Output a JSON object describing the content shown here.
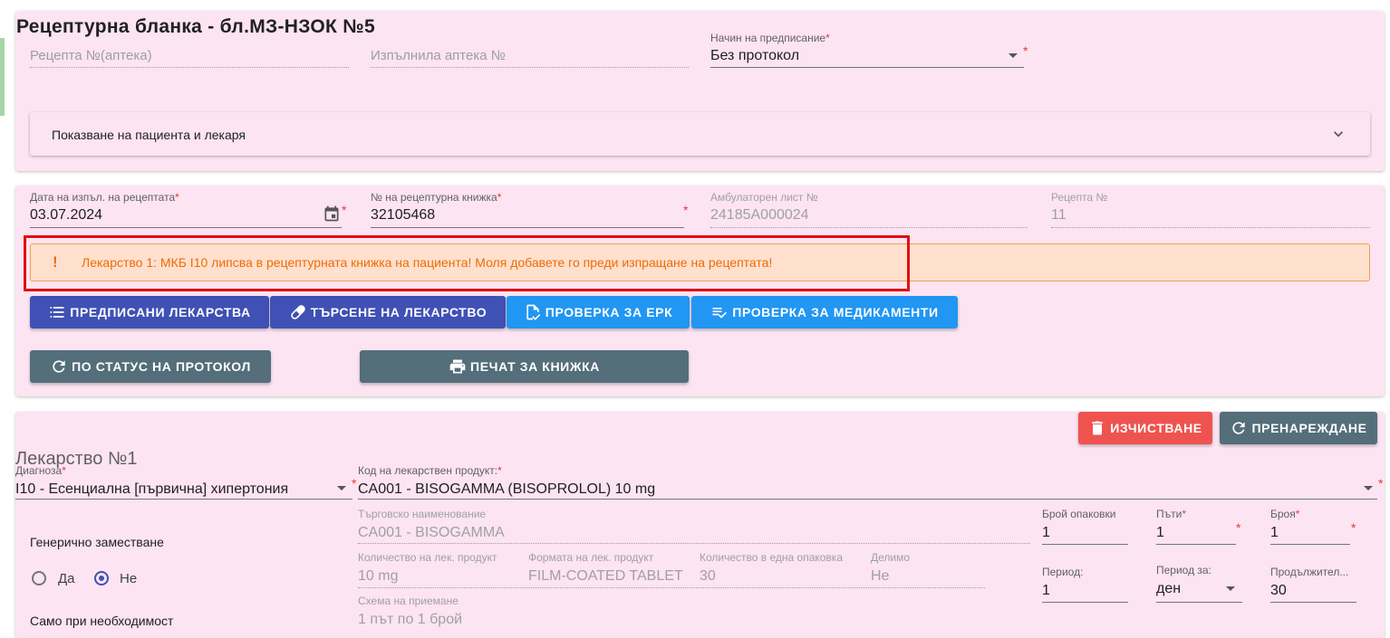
{
  "header": {
    "title": "Рецептурна бланка - бл.МЗ-НЗОК №5",
    "recipe_no_placeholder": "Рецепта №(аптека)",
    "pharmacy_placeholder": "Изпълнила аптека №",
    "method_label": "Начин на предписание",
    "method_value": "Без протокол",
    "expander_label": "Показване на пациента и лекаря"
  },
  "execution": {
    "date_label": "Дата на изпъл. на рецептата",
    "date_value": "03.07.2024",
    "book_label": "№ на рецептурна книжка",
    "book_value": "32105468",
    "amb_label": "Амбулаторен лист №",
    "amb_value": "24185A000024",
    "recipe_label": "Рецепта №",
    "recipe_value": "11"
  },
  "alert": {
    "icon": "!",
    "text": "Лекарство 1: МКБ I10 липсва в рецептурната книжка на пациента! Моля добавете го преди изпращане на рецептата!",
    "color": "#ef6c00"
  },
  "buttons": {
    "prescribed": "ПРЕДПИСАНИ ЛЕКАРСТВА",
    "search": "ТЪРСЕНЕ НА ЛЕКАРСТВО",
    "erk": "ПРОВЕРКА ЗА ЕРК",
    "medications": "ПРОВЕРКА ЗА МЕДИКАМЕНТИ",
    "protocol_status": "ПО СТАТУС НА ПРОТОКОЛ",
    "print": "ПЕЧАТ ЗА КНИЖКА",
    "clear": "ИЗЧИСТВАНЕ",
    "reorder": "ПРЕНАРЕЖДАНЕ"
  },
  "drug": {
    "heading": "Лекарство №1",
    "diagnosis_label": "Диагноза",
    "diagnosis_value": "I10 - Есенциална [първична] хипертония",
    "code_label": "Код на лекарствен продукт:",
    "code_value": "CA001 - BISOGAMMA (BISOPROLOL) 10 mg",
    "trade_label": "Търговско наименование",
    "trade_value": "CA001 - BISOGAMMA",
    "packages_label": "Брой опаковки",
    "packages_value": "1",
    "times_label": "Пъти",
    "times_value": "1",
    "count_label": "Броя",
    "count_value": "1",
    "generic_label": "Генерично заместване",
    "generic_yes": "Да",
    "generic_no": "Не",
    "generic_selected": "no",
    "qty_label": "Количество на лек. продукт",
    "qty_value": "10 mg",
    "form_label": "Формата на лек. продукт",
    "form_value": "FILM-COATED TABLET",
    "qty_pack_label": "Количество в една опаковка",
    "qty_pack_value": "30",
    "divisible_label": "Делимо",
    "divisible_value": "Не",
    "period_label": "Период:",
    "period_value": "1",
    "period_for_label": "Период за:",
    "period_for_value": "ден",
    "duration_label": "Продължител...",
    "duration_value": "30",
    "scheme_label": "Схема на приемане",
    "scheme_value": "1 път по 1 брой",
    "when_needed_label": "Само при необходимост"
  }
}
